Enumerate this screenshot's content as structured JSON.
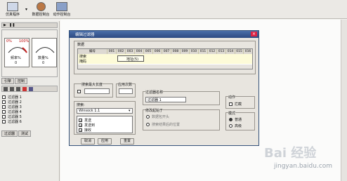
{
  "toolbar": {
    "items": [
      {
        "label": "仿真程序",
        "icon": "program-icon"
      },
      {
        "label": "数据控制台",
        "icon": "console-icon"
      },
      {
        "label": "动作控制台",
        "icon": "action-console-icon"
      }
    ]
  },
  "left": {
    "gauge1": {
      "min": "0%",
      "max": "100%",
      "label": "频率%",
      "value": "0"
    },
    "gauge2": {
      "label": "数量%",
      "value": "0"
    },
    "tabs": [
      "引擎",
      "控制"
    ],
    "filters": [
      "过滤器 1",
      "过滤器 2",
      "过滤器 3",
      "过滤器 4",
      "过滤器 5",
      "过滤器 6"
    ],
    "bottom_tabs": [
      "过滤器",
      "测试"
    ]
  },
  "dialog": {
    "title": "编辑过滤器",
    "data_group_label": "数据",
    "table": {
      "columns": [
        "编号",
        "001",
        "002",
        "003",
        "004",
        "005",
        "006",
        "007",
        "008",
        "009",
        "010",
        "011",
        "012",
        "013",
        "014",
        "015",
        "016"
      ],
      "rows": [
        "搜索",
        "掩码"
      ],
      "tooltip": "地址(5)"
    },
    "search_max_len_label": "搜索最大长度",
    "use_count_label": "应用次数",
    "search_group_label": "搜索:",
    "search_select": "Winsock 1.1",
    "functions": [
      "发送",
      "发送到",
      "接收"
    ],
    "filter_name_label": "过滤器名称",
    "filter_name_value": "过滤器 1",
    "action_label": "动作",
    "action_option": "拦截",
    "modify_label": "修改起始于",
    "modify_options": [
      "数据包开头",
      "搜索结果后的位置"
    ],
    "mode_label": "模式",
    "mode_options": [
      "普通",
      "高级"
    ],
    "buttons": {
      "cancel": "取消",
      "apply": "应用",
      "reset": "重置"
    }
  },
  "watermark": {
    "brand": "Bai 经验",
    "url": "jingyan.baidu.com"
  }
}
